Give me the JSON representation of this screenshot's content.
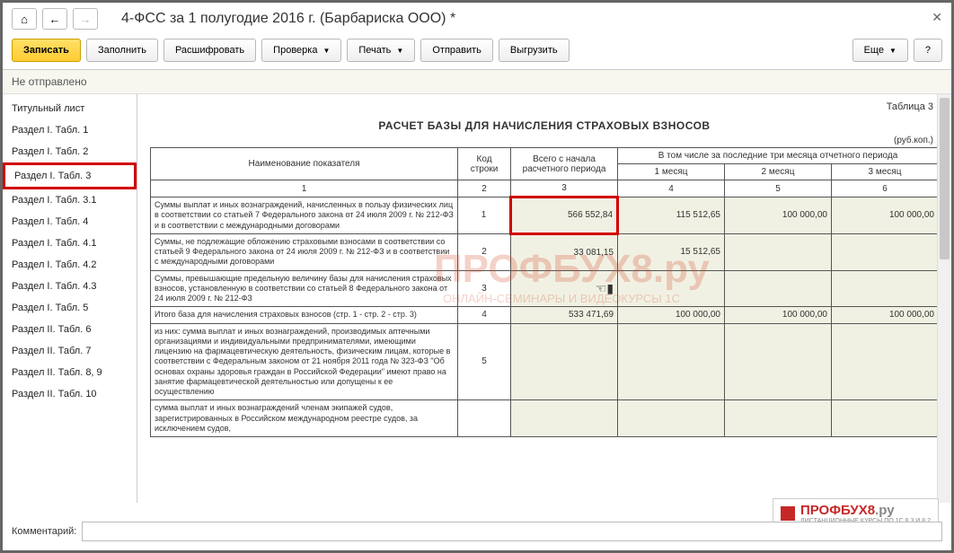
{
  "header": {
    "title": "4-ФСС за 1 полугодие 2016 г. (Барбариска ООО) *"
  },
  "toolbar": {
    "save": "Записать",
    "fill": "Заполнить",
    "decode": "Расшифровать",
    "check": "Проверка",
    "print": "Печать",
    "send": "Отправить",
    "export": "Выгрузить",
    "more": "Еще",
    "help": "?"
  },
  "status": "Не отправлено",
  "sidebar": {
    "items": [
      {
        "label": "Титульный лист"
      },
      {
        "label": "Раздел I. Табл. 1"
      },
      {
        "label": "Раздел I. Табл. 2"
      },
      {
        "label": "Раздел I. Табл. 3",
        "selected": true
      },
      {
        "label": "Раздел I. Табл. 3.1"
      },
      {
        "label": "Раздел I. Табл. 4"
      },
      {
        "label": "Раздел I. Табл. 4.1"
      },
      {
        "label": "Раздел I. Табл. 4.2"
      },
      {
        "label": "Раздел I. Табл. 4.3"
      },
      {
        "label": "Раздел I. Табл. 5"
      },
      {
        "label": "Раздел II. Табл. 6"
      },
      {
        "label": "Раздел II. Табл. 7"
      },
      {
        "label": "Раздел II. Табл. 8, 9"
      },
      {
        "label": "Раздел II. Табл. 10"
      }
    ]
  },
  "table": {
    "label_right": "Таблица 3",
    "caption": "РАСЧЕТ БАЗЫ ДЛЯ НАЧИСЛЕНИЯ СТРАХОВЫХ ВЗНОСОВ",
    "unit": "(руб.коп.)",
    "headers": {
      "name": "Наименование показателя",
      "code": "Код строки",
      "total": "Всего с начала расчетного периода",
      "last3": "В том числе за последние три месяца отчетного периода",
      "m1": "1 месяц",
      "m2": "2 месяц",
      "m3": "3 месяц"
    },
    "colnums": [
      "1",
      "2",
      "3",
      "4",
      "5",
      "6"
    ],
    "rows": [
      {
        "desc": "Суммы выплат и иных вознаграждений, начисленных в пользу физических лиц в соответствии со статьей 7 Федерального закона от 24 июля 2009 г. № 212-ФЗ и в соответствии с международными договорами",
        "code": "1",
        "total": "566 552,84",
        "m1": "115 512,65",
        "m2": "100 000,00",
        "m3": "100 000,00",
        "highlight_total": true
      },
      {
        "desc": "Суммы, не подлежащие обложению страховыми взносами в соответствии со статьей 9 Федерального закона от 24 июля 2009 г. № 212-ФЗ и в соответствии с международными договорами",
        "code": "2",
        "total": "33 081,15",
        "m1": "15 512,65",
        "m2": "",
        "m3": ""
      },
      {
        "desc": "Суммы, превышающие предельную величину базы для начисления страховых взносов, установленную в соответствии со статьей 8 Федерального закона от 24 июля 2009 г. № 212-ФЗ",
        "code": "3",
        "total": "",
        "m1": "",
        "m2": "",
        "m3": "",
        "hand": true
      },
      {
        "desc": "Итого база для начисления страховых взносов (стр. 1 - стр. 2 - стр. 3)",
        "code": "4",
        "total": "533 471,69",
        "m1": "100 000,00",
        "m2": "100 000,00",
        "m3": "100 000,00"
      },
      {
        "desc": "из них:\nсумма выплат и иных вознаграждений, производимых аптечными организациями и индивидуальными предпринимателями, имеющими лицензию на фармацевтическую деятельность, физическим лицам, которые в соответствии с Федеральным законом от 21 ноября 2011 года № 323-ФЗ \"Об основах охраны здоровья граждан в Российской Федерации\" имеют право на занятие фармацевтической деятельностью или допущены к ее осуществлению",
        "code": "5",
        "total": "",
        "m1": "",
        "m2": "",
        "m3": ""
      },
      {
        "desc": "сумма выплат и иных вознаграждений членам экипажей судов, зарегистрированных в Российском международном реестре судов, за исключением судов,",
        "code": "",
        "total": "",
        "m1": "",
        "m2": "",
        "m3": ""
      }
    ]
  },
  "watermark": {
    "main": "ПРОФБУХ8.ру",
    "sub": "ОНЛАЙН-СЕМИНАРЫ И ВИДЕОКУРСЫ 1С"
  },
  "footer": {
    "label": "Комментарий:"
  },
  "logo": {
    "text": "ПРОФБУХ8",
    "suffix": ".ру",
    "sub": "ДИСТАНЦИОННЫЕ КУРСЫ ПО 1С 8.3 И 8.2"
  }
}
